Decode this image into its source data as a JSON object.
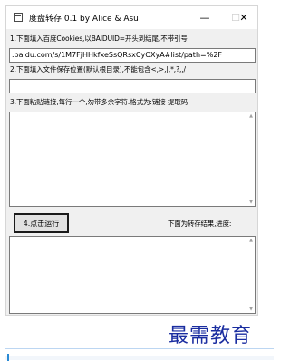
{
  "window": {
    "title": "度盘转存 0.1 by Alice & Asu",
    "minimize_glyph": "—",
    "maximize_glyph": "☐",
    "close_glyph": "✕"
  },
  "cookies": {
    "label": "1.下面填入百度Cookies,以BAIDUID=开头到结尾,不带引号",
    "value": ".baidu.com/s/1M7FjHHkfxeSsQRsxCyOXyA#list/path=%2F"
  },
  "save_path": {
    "label": "2.下面填入文件保存位置(默认根目录),不能包含<,>,|,*,?,,/",
    "value": ""
  },
  "links": {
    "label": "3.下面粘贴链接,每行一个,勿带多余字符.格式为:链接 提取码",
    "value": ""
  },
  "run": {
    "button_label": "4.点击运行",
    "status_label": "下面为转存结果,进度:"
  },
  "result": {
    "value": ""
  },
  "watermark": {
    "text": "最需教育"
  }
}
